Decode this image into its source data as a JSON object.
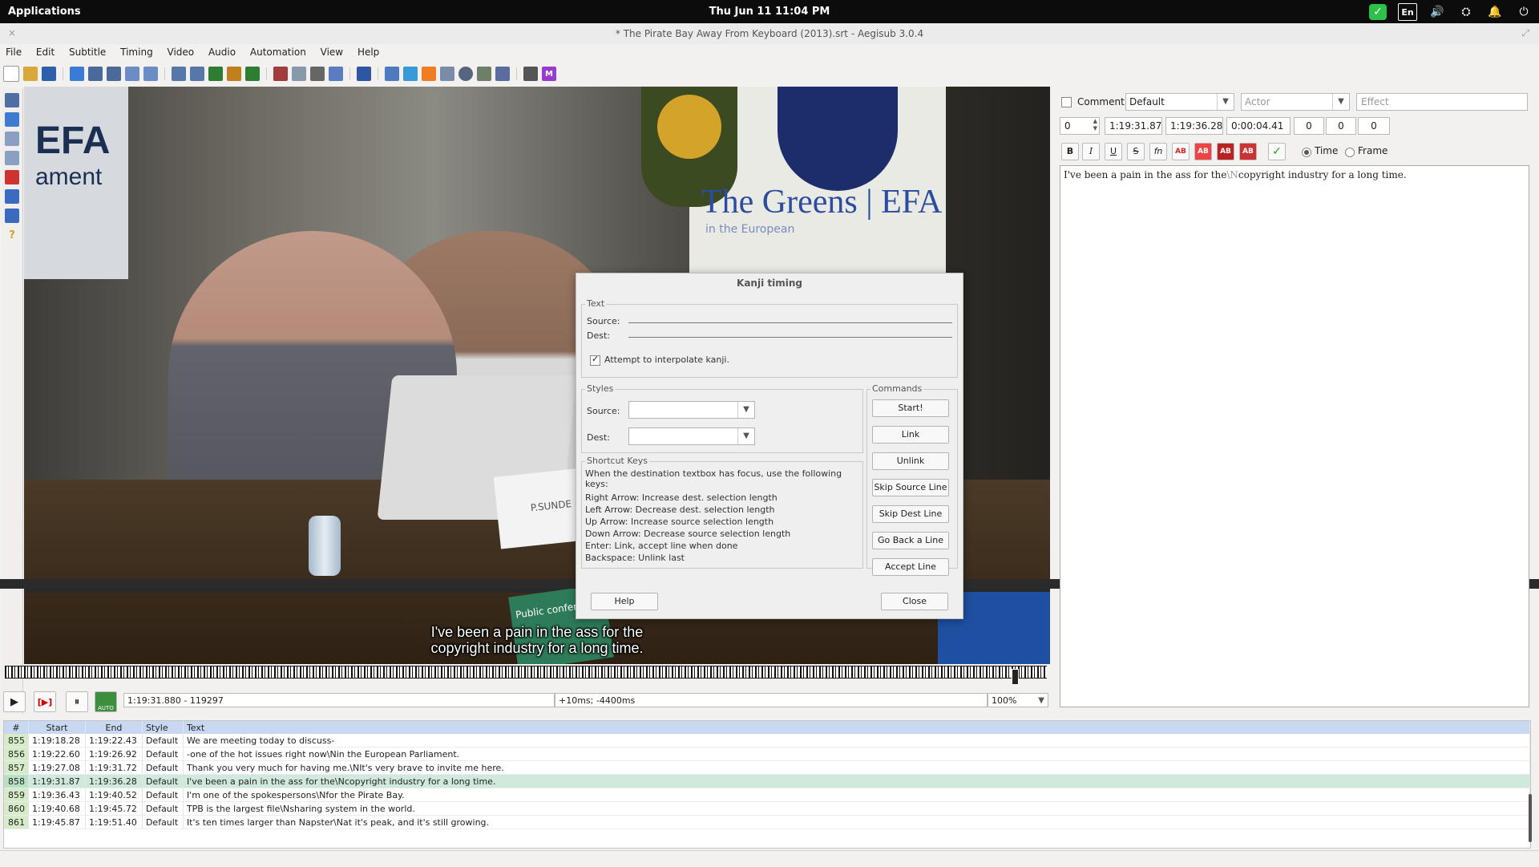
{
  "topbar": {
    "apps": "Applications",
    "clock": "Thu Jun 11    11:04 PM",
    "tray": [
      {
        "icon": "check-icon",
        "glyph": "✓"
      },
      {
        "icon": "keyboard-layout-icon",
        "glyph": "En"
      },
      {
        "icon": "volume-icon",
        "glyph": "🔊"
      },
      {
        "icon": "network-icon",
        "glyph": "⛭"
      },
      {
        "icon": "notification-bell-icon",
        "glyph": "🔔"
      },
      {
        "icon": "power-icon",
        "glyph": "⏻"
      }
    ]
  },
  "window": {
    "title": "* The Pirate Bay Away From Keyboard (2013).srt - Aegisub 3.0.4",
    "close": "×",
    "maximize": "⤢"
  },
  "menu": [
    "File",
    "Edit",
    "Subtitle",
    "Timing",
    "Video",
    "Audio",
    "Automation",
    "View",
    "Help"
  ],
  "edit_panel": {
    "comment_label": "Comment",
    "style": "Default",
    "actor_placeholder": "Actor",
    "effect_placeholder": "Effect",
    "layer": "0",
    "start": "1:19:31.87",
    "end": "1:19:36.28",
    "duration": "0:00:04.41",
    "margin_l": "0",
    "margin_r": "0",
    "margin_v": "0",
    "bold": "B",
    "italic": "I",
    "underline": "U",
    "strike": "S",
    "fn": "fn",
    "color_label": "AB",
    "commit": "✓",
    "time_label": "Time",
    "frame_label": "Frame",
    "text_before": "I've been a pain in the ass for the",
    "text_newline": "\\N",
    "text_after": "copyright industry for a long time."
  },
  "video": {
    "sign_efa": "EFA",
    "sign_ament": "ament",
    "sign_greens": "The Greens | EFA",
    "sign_greens_sub": "in the European",
    "card_text": "P.SUNDE",
    "public_sign": "Public conference",
    "subtitle_line1": "I've been a pain in the ass for the",
    "subtitle_line2": "copyright industry for a long time."
  },
  "video_controls": {
    "play": "▶",
    "play_line": "[▶]",
    "pause": "⏸",
    "auto": "AUTO",
    "time_frame": "1:19:31.880 - 119297",
    "offset": "+10ms; -4400ms",
    "zoom": "100%",
    "seek_position": 0.966
  },
  "dialog": {
    "title": "Kanji timing",
    "text_group": "Text",
    "source_label": "Source:",
    "dest_label": "Dest:",
    "interpolate_label": "Attempt to interpolate kanji.",
    "interpolate_checked": true,
    "styles_group": "Styles",
    "styles_source_label": "Source:",
    "styles_dest_label": "Dest:",
    "commands_group": "Commands",
    "buttons": [
      "Start!",
      "Link",
      "Unlink",
      "Skip Source Line",
      "Skip Dest Line",
      "Go Back a Line",
      "Accept Line"
    ],
    "shortcut_group": "Shortcut Keys",
    "shortcut_intro": "When the destination textbox has focus, use the following keys:",
    "shortcuts": [
      "Right Arrow: Increase dest. selection length",
      "Left Arrow: Decrease dest. selection length",
      "Up Arrow: Increase source selection length",
      "Down Arrow: Decrease source selection length",
      "Enter: Link, accept line when done",
      "Backspace: Unlink last"
    ],
    "help": "Help",
    "close": "Close"
  },
  "grid": {
    "headers": [
      "#",
      "Start",
      "End",
      "Style",
      "Text"
    ],
    "rows": [
      {
        "num": "855",
        "start": "1:19:18.28",
        "end": "1:19:22.43",
        "style": "Default",
        "text": "We are meeting today to discuss-"
      },
      {
        "num": "856",
        "start": "1:19:22.60",
        "end": "1:19:26.92",
        "style": "Default",
        "text": "-one of the hot issues right now\\Nin the European Parliament."
      },
      {
        "num": "857",
        "start": "1:19:27.08",
        "end": "1:19:31.72",
        "style": "Default",
        "text": "Thank you very much for having me.\\NIt's very brave to invite me here."
      },
      {
        "num": "858",
        "start": "1:19:31.87",
        "end": "1:19:36.28",
        "style": "Default",
        "text": "I've been a pain in the ass for the\\Ncopyright industry for a long time.",
        "selected": true
      },
      {
        "num": "859",
        "start": "1:19:36.43",
        "end": "1:19:40.52",
        "style": "Default",
        "text": "I'm one of the spokespersons\\Nfor the Pirate Bay."
      },
      {
        "num": "860",
        "start": "1:19:40.68",
        "end": "1:19:45.72",
        "style": "Default",
        "text": "TPB is the largest file\\Nsharing system in the world."
      },
      {
        "num": "861",
        "start": "1:19:45.87",
        "end": "1:19:51.40",
        "style": "Default",
        "text": "It's ten times larger than Napster\\Nat it's peak, and it's still growing."
      }
    ]
  }
}
